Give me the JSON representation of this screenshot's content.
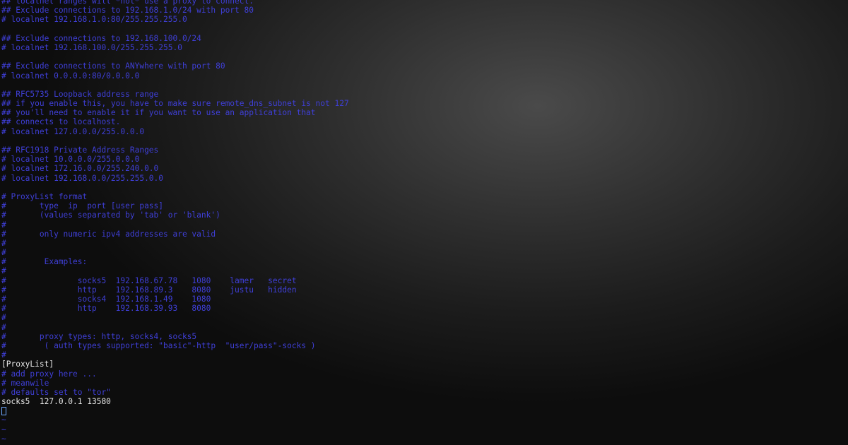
{
  "colors": {
    "comment": "#3f3fd7",
    "text": "#e6e6e6",
    "cursor": "#6fa8ff",
    "background": "#111111"
  },
  "lines": [
    {
      "text": "## localnet ranges will *not* use a proxy to connect.",
      "kind": "comment"
    },
    {
      "text": "## Exclude connections to 192.168.1.0/24 with port 80",
      "kind": "comment"
    },
    {
      "text": "# localnet 192.168.1.0:80/255.255.255.0",
      "kind": "comment"
    },
    {
      "text": "",
      "kind": "comment"
    },
    {
      "text": "## Exclude connections to 192.168.100.0/24",
      "kind": "comment"
    },
    {
      "text": "# localnet 192.168.100.0/255.255.255.0",
      "kind": "comment"
    },
    {
      "text": "",
      "kind": "comment"
    },
    {
      "text": "## Exclude connections to ANYwhere with port 80",
      "kind": "comment"
    },
    {
      "text": "# localnet 0.0.0.0:80/0.0.0.0",
      "kind": "comment"
    },
    {
      "text": "",
      "kind": "comment"
    },
    {
      "text": "## RFC5735 Loopback address range",
      "kind": "comment"
    },
    {
      "text": "## if you enable this, you have to make sure remote_dns_subnet is not 127",
      "kind": "comment"
    },
    {
      "text": "## you'll need to enable it if you want to use an application that",
      "kind": "comment"
    },
    {
      "text": "## connects to localhost.",
      "kind": "comment"
    },
    {
      "text": "# localnet 127.0.0.0/255.0.0.0",
      "kind": "comment"
    },
    {
      "text": "",
      "kind": "comment"
    },
    {
      "text": "## RFC1918 Private Address Ranges",
      "kind": "comment"
    },
    {
      "text": "# localnet 10.0.0.0/255.0.0.0",
      "kind": "comment"
    },
    {
      "text": "# localnet 172.16.0.0/255.240.0.0",
      "kind": "comment"
    },
    {
      "text": "# localnet 192.168.0.0/255.255.0.0",
      "kind": "comment"
    },
    {
      "text": "",
      "kind": "comment"
    },
    {
      "text": "# ProxyList format",
      "kind": "comment"
    },
    {
      "text": "#       type  ip  port [user pass]",
      "kind": "comment"
    },
    {
      "text": "#       (values separated by 'tab' or 'blank')",
      "kind": "comment"
    },
    {
      "text": "#",
      "kind": "comment"
    },
    {
      "text": "#       only numeric ipv4 addresses are valid",
      "kind": "comment"
    },
    {
      "text": "#",
      "kind": "comment"
    },
    {
      "text": "#",
      "kind": "comment"
    },
    {
      "text": "#        Examples:",
      "kind": "comment"
    },
    {
      "text": "#",
      "kind": "comment"
    },
    {
      "text": "#               socks5  192.168.67.78   1080    lamer   secret",
      "kind": "comment"
    },
    {
      "text": "#               http    192.168.89.3    8080    justu   hidden",
      "kind": "comment"
    },
    {
      "text": "#               socks4  192.168.1.49    1080",
      "kind": "comment"
    },
    {
      "text": "#               http    192.168.39.93   8080",
      "kind": "comment"
    },
    {
      "text": "#",
      "kind": "comment"
    },
    {
      "text": "#",
      "kind": "comment"
    },
    {
      "text": "#       proxy types: http, socks4, socks5",
      "kind": "comment"
    },
    {
      "text": "#        ( auth types supported: \"basic\"-http  \"user/pass\"-socks )",
      "kind": "comment"
    },
    {
      "text": "#",
      "kind": "comment"
    },
    {
      "text": "[ProxyList]",
      "kind": "normal"
    },
    {
      "text": "# add proxy here ...",
      "kind": "comment"
    },
    {
      "text": "# meanwile",
      "kind": "comment"
    },
    {
      "text": "# defaults set to \"tor\"",
      "kind": "comment"
    },
    {
      "text": "socks5  127.0.0.1 13580",
      "kind": "normal"
    },
    {
      "text": "",
      "kind": "cursor"
    },
    {
      "text": "~",
      "kind": "tilde"
    },
    {
      "text": "~",
      "kind": "tilde"
    },
    {
      "text": "~",
      "kind": "tilde"
    }
  ]
}
